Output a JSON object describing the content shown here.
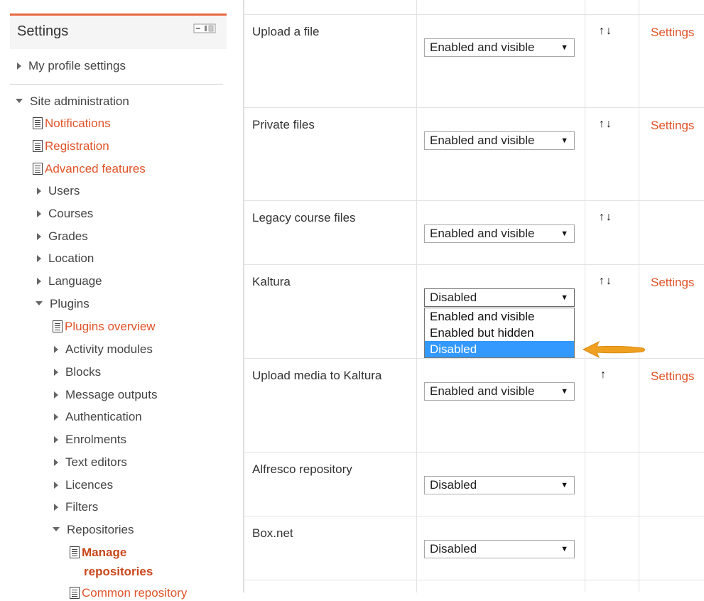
{
  "sidebar": {
    "title": "Settings",
    "items": [
      {
        "label": "My profile settings"
      },
      {
        "label": "Site administration"
      },
      {
        "label": "Notifications"
      },
      {
        "label": "Registration"
      },
      {
        "label": "Advanced features"
      },
      {
        "label": "Users"
      },
      {
        "label": "Courses"
      },
      {
        "label": "Grades"
      },
      {
        "label": "Location"
      },
      {
        "label": "Language"
      },
      {
        "label": "Plugins"
      },
      {
        "label": "Plugins overview"
      },
      {
        "label": "Activity modules"
      },
      {
        "label": "Blocks"
      },
      {
        "label": "Message outputs"
      },
      {
        "label": "Authentication"
      },
      {
        "label": "Enrolments"
      },
      {
        "label": "Text editors"
      },
      {
        "label": "Licences"
      },
      {
        "label": "Filters"
      },
      {
        "label": "Repositories"
      },
      {
        "label": "Manage"
      },
      {
        "label": "repositories"
      },
      {
        "label": "Common repository"
      }
    ]
  },
  "table": {
    "settings_label": "Settings",
    "rows": [
      {
        "name": "Upload a file",
        "value": "Enabled and visible",
        "arrows": "↑↓"
      },
      {
        "name": "Private files",
        "value": "Enabled and visible",
        "arrows": "↑↓"
      },
      {
        "name": "Legacy course files",
        "value": "Enabled and visible",
        "arrows": "↑↓"
      },
      {
        "name": "Kaltura",
        "value": "Disabled",
        "arrows": "↑↓"
      },
      {
        "name": "Upload media to Kaltura",
        "value": "Enabled and visible",
        "arrows": "↑"
      },
      {
        "name": "Alfresco repository",
        "value": "Disabled"
      },
      {
        "name": "Box.net",
        "value": "Disabled"
      }
    ]
  },
  "dropdown": {
    "options": [
      "Enabled and visible",
      "Enabled but hidden",
      "Disabled"
    ],
    "selected": "Disabled"
  },
  "colors": {
    "link": "#e05328",
    "highlight": "#3399ff",
    "arrow": "#f0a020"
  }
}
